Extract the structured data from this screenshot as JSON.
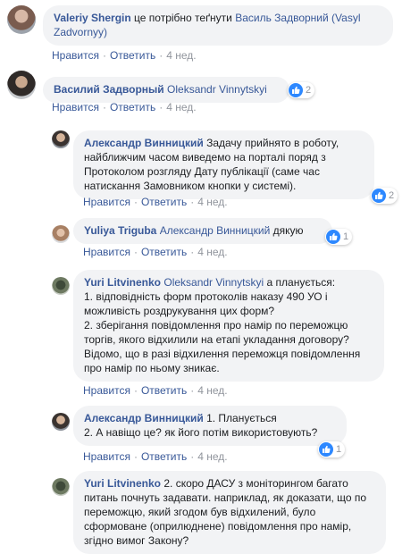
{
  "comments": [
    {
      "author": "Valeriy Shergin",
      "text_before": " це потрібно теґнути ",
      "mention": "Василь Задворний (Vasyl Zadvornyy)",
      "text_after": "",
      "like_label": "Нравится",
      "reply_label": "Ответить",
      "time": "4 нед."
    },
    {
      "author": "Василий Задворный",
      "mention": "Oleksandr Vinnytskyi",
      "reaction_count": "2",
      "like_label": "Нравится",
      "reply_label": "Ответить",
      "time": "4 нед."
    }
  ],
  "replies": [
    {
      "author": "Александр Винницкий",
      "text": " Задачу прийнято в роботу, найближчим часом виведемо на порталі поряд з Протоколом розгляду Дату публікації (саме час натискання Замовником кнопки у системі).",
      "reaction_count": "2",
      "like_label": "Нравится",
      "reply_label": "Ответить",
      "time": "4 нед."
    },
    {
      "author": "Yuliya Triguba",
      "mention": "Александр Винницкий",
      "text_after": " дякую",
      "reaction_count": "1",
      "like_label": "Нравится",
      "reply_label": "Ответить",
      "time": "4 нед."
    },
    {
      "author": "Yuri Litvinenko",
      "mention": "Oleksandr Vinnytskyi",
      "text_after": " а планується:",
      "lines": [
        "1. відповідність форм протоколів наказу 490 УО і можливість роздрукування цих форм?",
        "2. зберігання повідомлення про намір по переможцю торгів, якого відхилили на етапі укладання договору? Відомо, що в разі відхилення переможця повідомлення про намір по ньому зникає."
      ],
      "like_label": "Нравится",
      "reply_label": "Ответить",
      "time": "4 нед."
    },
    {
      "author": "Александр Винницкий",
      "text_after": " 1. Планується",
      "line2": "2. А навіщо це? як його потім використовують?",
      "reaction_count": "1",
      "like_label": "Нравится",
      "reply_label": "Ответить",
      "time": "4 нед."
    },
    {
      "author": "Yuri Litvinenko",
      "text_after": " 2. скоро ДАСУ з моніторингом багато питань почнуть задавати. наприклад, як доказати, що по переможцю, який згодом був відхилений, було сформоване (оприлюднене) повідомлення про намір, згідно вимог Закону?"
    }
  ],
  "colors": {
    "link": "#385898",
    "bubble": "#f2f3f5",
    "muted": "#90949c",
    "like_blue": "#2d88ff"
  }
}
